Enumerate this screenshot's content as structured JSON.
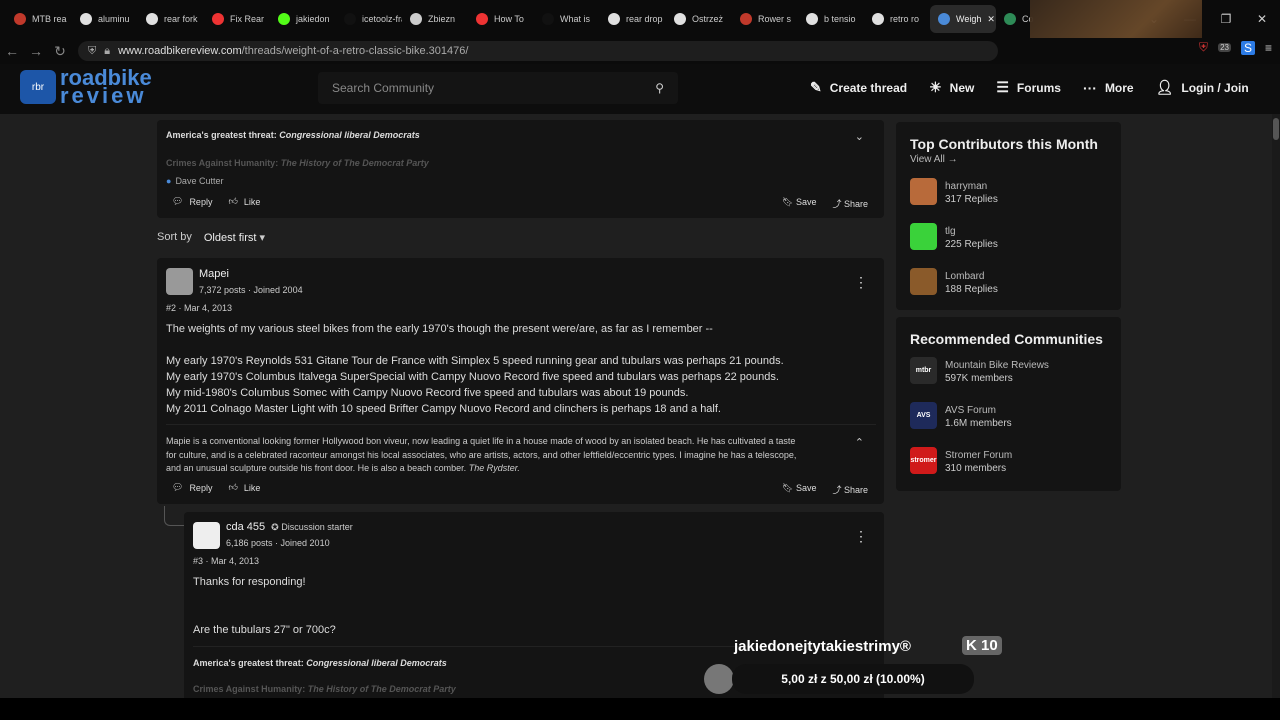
{
  "tabs": [
    {
      "label": "MTB rea",
      "color": "#c0392b"
    },
    {
      "label": "aluminu",
      "color": "#e0e0e0"
    },
    {
      "label": "rear fork",
      "color": "#e0e0e0"
    },
    {
      "label": "Fix Rear",
      "color": "#e33"
    },
    {
      "label": "jakiedon",
      "color": "#53fc18"
    },
    {
      "label": "icetoolz-fran",
      "color": "#111"
    },
    {
      "label": "Zbiezn",
      "color": "#ccc"
    },
    {
      "label": "How To",
      "color": "#e33"
    },
    {
      "label": "What is",
      "color": "#111"
    },
    {
      "label": "rear drop",
      "color": "#e0e0e0"
    },
    {
      "label": "Ostrzeż",
      "color": "#e0e0e0"
    },
    {
      "label": "Rower s",
      "color": "#c0392b"
    },
    {
      "label": "b tensio",
      "color": "#e0e0e0"
    },
    {
      "label": "retro ro",
      "color": "#e0e0e0"
    },
    {
      "label": "Weigh",
      "color": "#4a8ad8",
      "active": true
    },
    {
      "label": "Co",
      "color": "#2e8b57"
    }
  ],
  "url": {
    "host": "www.roadbikereview.com",
    "path": "/threads/weight-of-a-retro-classic-bike.301476/"
  },
  "badge_count": "23",
  "site": {
    "logo_line1": "roadbike",
    "logo_line2": "review",
    "search_placeholder": "Search Community",
    "nav": {
      "create": "Create thread",
      "new": "New",
      "forums": "Forums",
      "more": "More",
      "login": "Login / Join"
    }
  },
  "top_post": {
    "sig1_prefix": "America's greatest threat:",
    "sig1_italic": "Congressional liberal Democrats",
    "sig2_prefix": "Crimes Against Humanity:",
    "sig2_italic": "The History of The Democrat Party",
    "reaction": "Dave Cutter",
    "reply": "Reply",
    "like": "Like",
    "save": "Save",
    "share": "Share"
  },
  "sort": {
    "label": "Sort by",
    "value": "Oldest first"
  },
  "post2": {
    "user": "Mapei",
    "meta": "7,372 posts · Joined 2004",
    "num": "#2 · Mar 4, 2013",
    "lines": [
      "The weights of my various steel bikes from the early 1970's though the present were/are, as far as I remember --",
      "",
      "My early 1970's Reynolds 531 Gitane Tour de France with Simplex 5 speed running gear and tubulars was perhaps 21 pounds.",
      "My early 1970's Columbus Italvega SuperSpecial with Campy Nuovo Record five speed and tubulars was perhaps 22 pounds.",
      "My mid-1980's Columbus Somec with Campy Nuovo Record five speed and tubulars was about 19 pounds.",
      "My 2011 Colnago Master Light with 10 speed Brifter Campy Nuovo Record and clinchers is perhaps 18 and a half."
    ],
    "sig": "Mapie is a conventional looking former Hollywood bon viveur, now leading a quiet life in a house made of wood by an isolated beach. He has cultivated a taste for culture, and is a celebrated raconteur amongst his local associates, who are artists, actors, and other leftfield/eccentric types. I imagine he has a telescope, and an unusual sculpture outside his front door. He is also a beach comber.",
    "sig_italic": "The Rydster.",
    "reply": "Reply",
    "like": "Like",
    "save": "Save",
    "share": "Share"
  },
  "post3": {
    "user": "cda 455",
    "starter": "Discussion starter",
    "meta": "6,186 posts · Joined 2010",
    "num": "#3 · Mar 4, 2013",
    "line1": "Thanks for responding!",
    "line2": "Are the tubulars 27\" or 700c?",
    "sig1_prefix": "America's greatest threat:",
    "sig1_italic": "Congressional liberal Democrats",
    "sig2_prefix": "Crimes Against Humanity:",
    "sig2_italic": "The History of The Democrat Party"
  },
  "contributors": {
    "title": "Top Contributors this Month",
    "view_all": "View All",
    "items": [
      {
        "name": "harryman",
        "count": "317 Replies",
        "color": "#b86a3a"
      },
      {
        "name": "tlg",
        "count": "225 Replies",
        "color": "#3ad23a"
      },
      {
        "name": "Lombard",
        "count": "188 Replies",
        "color": "#8a5a2a"
      }
    ]
  },
  "communities": {
    "title": "Recommended Communities",
    "items": [
      {
        "name": "Mountain Bike Reviews",
        "count": "597K members",
        "color": "#2a2a2a",
        "abbr": "mtbr"
      },
      {
        "name": "AVS Forum",
        "count": "1.6M members",
        "color": "#1e2a5a",
        "abbr": "AVS"
      },
      {
        "name": "Stromer Forum",
        "count": "310 members",
        "color": "#d01a1a",
        "abbr": "stromer"
      }
    ]
  },
  "stream": {
    "name": "jakiedonejtytakiestrimy®",
    "k": "10",
    "goal": "5,00 zł z 50,00 zł (10.00%)"
  }
}
